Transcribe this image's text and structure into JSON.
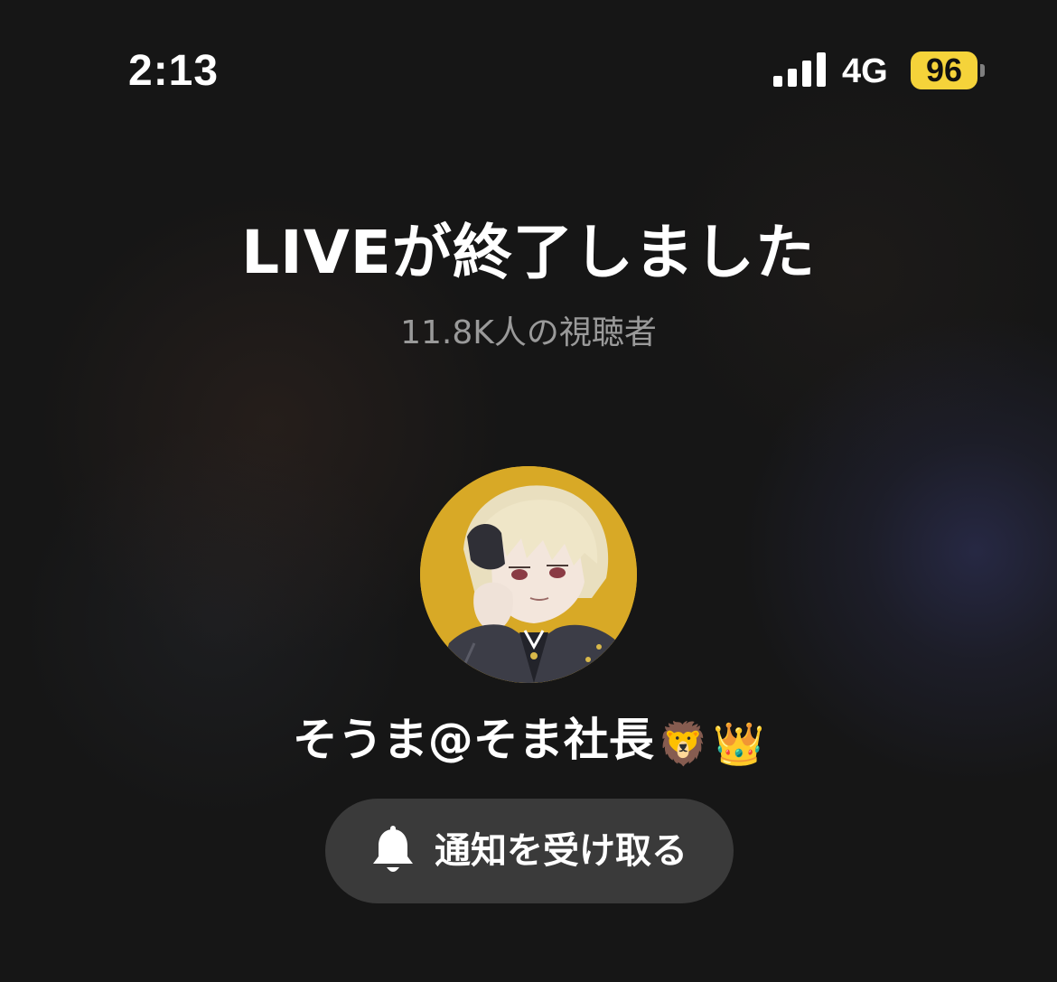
{
  "status_bar": {
    "time": "2:13",
    "network": "4G",
    "battery": "96",
    "signal_icon": "signal-bars-icon"
  },
  "live": {
    "title": "LIVEが終了しました",
    "viewers": "11.8K人の視聴者"
  },
  "streamer": {
    "name": "そうま@そま社長",
    "badges": [
      "🦁",
      "👑"
    ],
    "avatar_icon": "anime-avatar"
  },
  "notify_button": {
    "label": "通知を受け取る",
    "icon": "bell-icon"
  },
  "colors": {
    "background": "#161616",
    "battery_fill": "#f5d33a",
    "button_bg": "#3a3a3a",
    "subtext": "#9a9a9a",
    "avatar_bg": "#d8a926"
  }
}
